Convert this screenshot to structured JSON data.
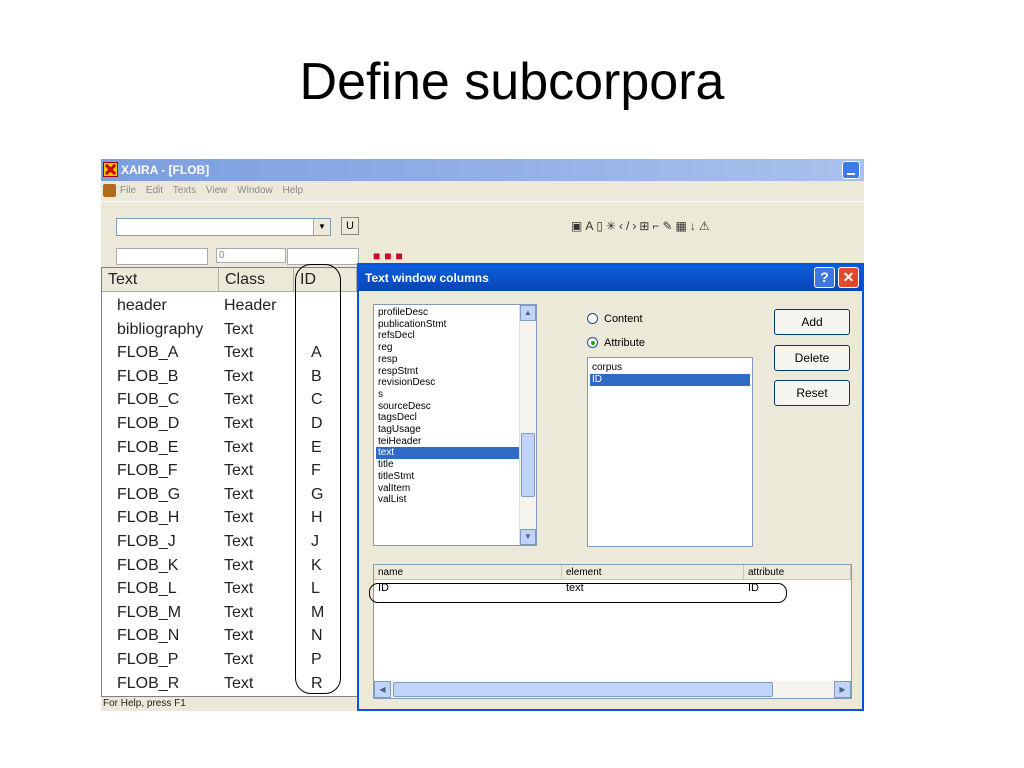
{
  "slide": {
    "title": "Define subcorpora"
  },
  "app": {
    "title": "XAIRA - [FLOB]",
    "menu": [
      "File",
      "Edit",
      "Texts",
      "View",
      "Window",
      "Help"
    ],
    "u_button": "U",
    "tb2_field2": "0",
    "status": "For Help, press F1"
  },
  "list": {
    "headers": [
      "Text",
      "Class",
      "ID"
    ],
    "rows": [
      {
        "text": "header",
        "class": "Header",
        "id": ""
      },
      {
        "text": "bibliography",
        "class": "Text",
        "id": ""
      },
      {
        "text": "FLOB_A",
        "class": "Text",
        "id": "A"
      },
      {
        "text": "FLOB_B",
        "class": "Text",
        "id": "B"
      },
      {
        "text": "FLOB_C",
        "class": "Text",
        "id": "C"
      },
      {
        "text": "FLOB_D",
        "class": "Text",
        "id": "D"
      },
      {
        "text": "FLOB_E",
        "class": "Text",
        "id": "E"
      },
      {
        "text": "FLOB_F",
        "class": "Text",
        "id": "F"
      },
      {
        "text": "FLOB_G",
        "class": "Text",
        "id": "G"
      },
      {
        "text": "FLOB_H",
        "class": "Text",
        "id": "H"
      },
      {
        "text": "FLOB_J",
        "class": "Text",
        "id": "J"
      },
      {
        "text": "FLOB_K",
        "class": "Text",
        "id": "K"
      },
      {
        "text": "FLOB_L",
        "class": "Text",
        "id": "L"
      },
      {
        "text": "FLOB_M",
        "class": "Text",
        "id": "M"
      },
      {
        "text": "FLOB_N",
        "class": "Text",
        "id": "N"
      },
      {
        "text": "FLOB_P",
        "class": "Text",
        "id": "P"
      },
      {
        "text": "FLOB_R",
        "class": "Text",
        "id": "R"
      }
    ]
  },
  "dialog": {
    "title": "Text window columns",
    "help_label": "?",
    "close_label": "✕",
    "elements": [
      "profileDesc",
      "publicationStmt",
      "refsDecl",
      "reg",
      "resp",
      "respStmt",
      "revisionDesc",
      "s",
      "sourceDesc",
      "tagsDecl",
      "tagUsage",
      "teiHeader",
      "text",
      "title",
      "titleStmt",
      "valItem",
      "valList"
    ],
    "selected_element": "text",
    "radio_content": "Content",
    "radio_attribute": "Attribute",
    "attributes": [
      "corpus",
      "ID"
    ],
    "selected_attribute": "ID",
    "buttons": {
      "add": "Add",
      "delete": "Delete",
      "reset": "Reset"
    },
    "table": {
      "headers": [
        "name",
        "element",
        "attribute"
      ],
      "rows": [
        {
          "name": "ID",
          "element": "text",
          "attribute": "ID"
        }
      ]
    }
  }
}
